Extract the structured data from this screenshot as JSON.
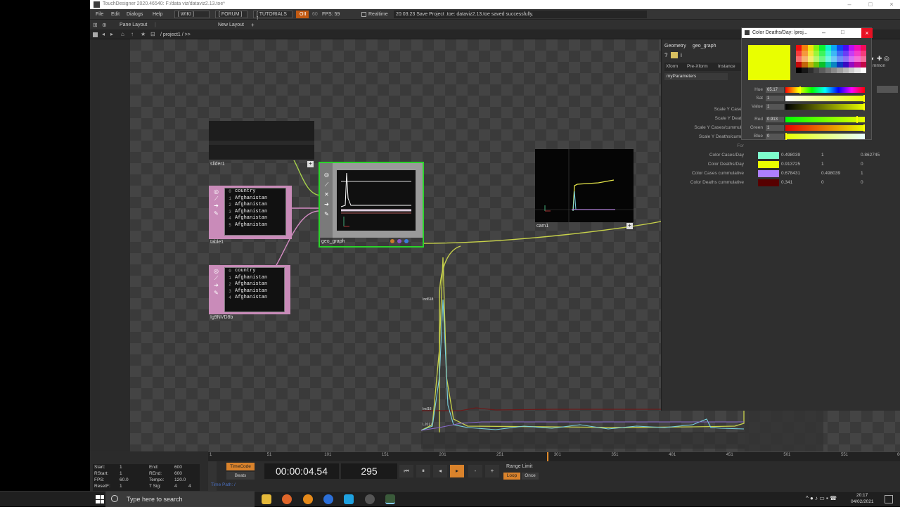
{
  "window": {
    "title": "TouchDesigner 2020.46540: F:/data viz/dataviz2.13.toe*",
    "controls": [
      "–",
      "□",
      "×"
    ]
  },
  "menubar": {
    "items": [
      "File",
      "Edit",
      "Dialogs",
      "Help"
    ],
    "tags": [
      "[ WIKI ]",
      "[ FORUM ]",
      "[ TUTORIALS ]"
    ],
    "oii": "OII",
    "fps_target": "60",
    "fps_label": "FPS: 59",
    "realtime_label": "Realtime",
    "status_message": "20:03:23 Save Project .toe: dataviz2.13.toe saved successfully."
  },
  "panebar": {
    "pane_layout": "Pane Layout",
    "new_layout": "New Layout",
    "add": "+"
  },
  "pathbar": {
    "path": "/ project1 / >>"
  },
  "nodes": {
    "slider": {
      "name": "slider1"
    },
    "table1": {
      "name": "table1",
      "rows": [
        {
          "n": "0",
          "v": "country"
        },
        {
          "n": "1",
          "v": "Afghanistan"
        },
        {
          "n": "2",
          "v": "Afghanistan"
        },
        {
          "n": "3",
          "v": "Afghanistan"
        },
        {
          "n": "4",
          "v": "Afghanistan"
        },
        {
          "n": "5",
          "v": "Afghanistan"
        }
      ]
    },
    "table2": {
      "name": "Ig9NVD8b",
      "rows": [
        {
          "n": "0",
          "v": "country"
        },
        {
          "n": "1",
          "v": "Afghanistan"
        },
        {
          "n": "2",
          "v": "Afghanistan"
        },
        {
          "n": "3",
          "v": "Afghanistan"
        },
        {
          "n": "4",
          "v": "Afghanistan"
        }
      ]
    },
    "geo": {
      "name": "geo_graph"
    },
    "cam": {
      "name": "cam1"
    }
  },
  "graph_overlay": {
    "upper_label": "Ind618",
    "mid_label": "Ind18",
    "low_label": "L2017"
  },
  "params": {
    "header": "Geometry",
    "op_name": "geo_graph",
    "tabs": [
      "Xform",
      "Pre-Xform",
      "Instance",
      "mmon"
    ],
    "page": "myParameters",
    "labels": [
      "Scale Y Cases",
      "Scale Y Death",
      "Scale Y Cases/cummula",
      "Scale Y Deaths/cumm",
      "For"
    ],
    "colors": [
      {
        "label": "Color Cases/Day",
        "hex": "#7dffcc",
        "v1": "0.498039",
        "v2": "1",
        "v3": "0.862745"
      },
      {
        "label": "Color Deaths/Day",
        "hex": "#e9ff00",
        "v1": "0.913725",
        "v2": "1",
        "v3": "0"
      },
      {
        "label": "Color Cases cummulative",
        "hex": "#ad7fff",
        "v1": "0.678431",
        "v2": "0.498039",
        "v3": "1"
      },
      {
        "label": "Color Deaths cummulative",
        "hex": "#570000",
        "v1": "0.341",
        "v2": "0",
        "v3": "0"
      }
    ]
  },
  "color_dialog": {
    "title": "Color Deaths/Day: /proj...",
    "current_color": "#e9ff00",
    "sliders": [
      {
        "label": "Hue",
        "value": "65.17",
        "level": 0.18
      },
      {
        "label": "Sat",
        "value": "1",
        "level": 1
      },
      {
        "label": "Value",
        "value": "1",
        "level": 1
      },
      {
        "label": "Red",
        "value": "0.913",
        "level": 0.913
      },
      {
        "label": "Green",
        "value": "1",
        "level": 1
      },
      {
        "label": "Blue",
        "value": "0",
        "level": 0
      }
    ]
  },
  "timeline": {
    "ticks": [
      "1",
      "51",
      "101",
      "151",
      "201",
      "251",
      "301",
      "351",
      "401",
      "451",
      "501",
      "551",
      "600"
    ],
    "playhead_frame": 295
  },
  "playbar": {
    "start_label": "Start:",
    "start": "1",
    "end_label": "End:",
    "end": "600",
    "rstart_label": "RStart:",
    "rstart": "1",
    "rend_label": "REnd:",
    "rend": "600",
    "fps_label": "FPS:",
    "fps": "60.0",
    "tempo_label": "Tempo:",
    "tempo": "120.0",
    "resetf_label": "ResetF:",
    "resetf": "1",
    "tsig_label": "T Sig:",
    "tsig1": "4",
    "tsig2": "4",
    "timecode_btn": "TimeCode",
    "beats_btn": "Beats",
    "timecode": "00:00:04.54",
    "frame": "295",
    "range_limit": "Range Limit",
    "loop": "Loop",
    "once": "Once",
    "time_path": "Time Path: /"
  },
  "taskbar": {
    "search_placeholder": "Type here to search",
    "time": "20:17",
    "date": "04/02/2021"
  }
}
